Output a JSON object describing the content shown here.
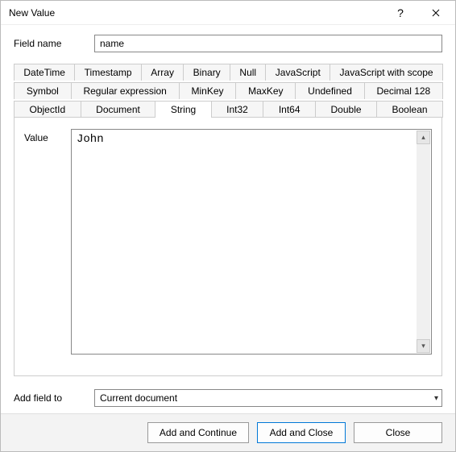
{
  "window": {
    "title": "New Value"
  },
  "form": {
    "field_name_label": "Field name",
    "field_name_value": "name",
    "value_label": "Value",
    "value_text": "John",
    "add_field_to_label": "Add field to",
    "add_field_to_value": "Current document"
  },
  "tabs": {
    "row1": [
      "DateTime",
      "Timestamp",
      "Array",
      "Binary",
      "Null",
      "JavaScript",
      "JavaScript with scope"
    ],
    "row2": [
      "Symbol",
      "Regular expression",
      "MinKey",
      "MaxKey",
      "Undefined",
      "Decimal 128"
    ],
    "row3": [
      "ObjectId",
      "Document",
      "String",
      "Int32",
      "Int64",
      "Double",
      "Boolean"
    ],
    "active": "String"
  },
  "buttons": {
    "add_continue": "Add and Continue",
    "add_close": "Add and Close",
    "close": "Close"
  },
  "icons": {
    "help": "?",
    "chevron_down": "▾",
    "scroll_up": "▴",
    "scroll_down": "▾"
  }
}
